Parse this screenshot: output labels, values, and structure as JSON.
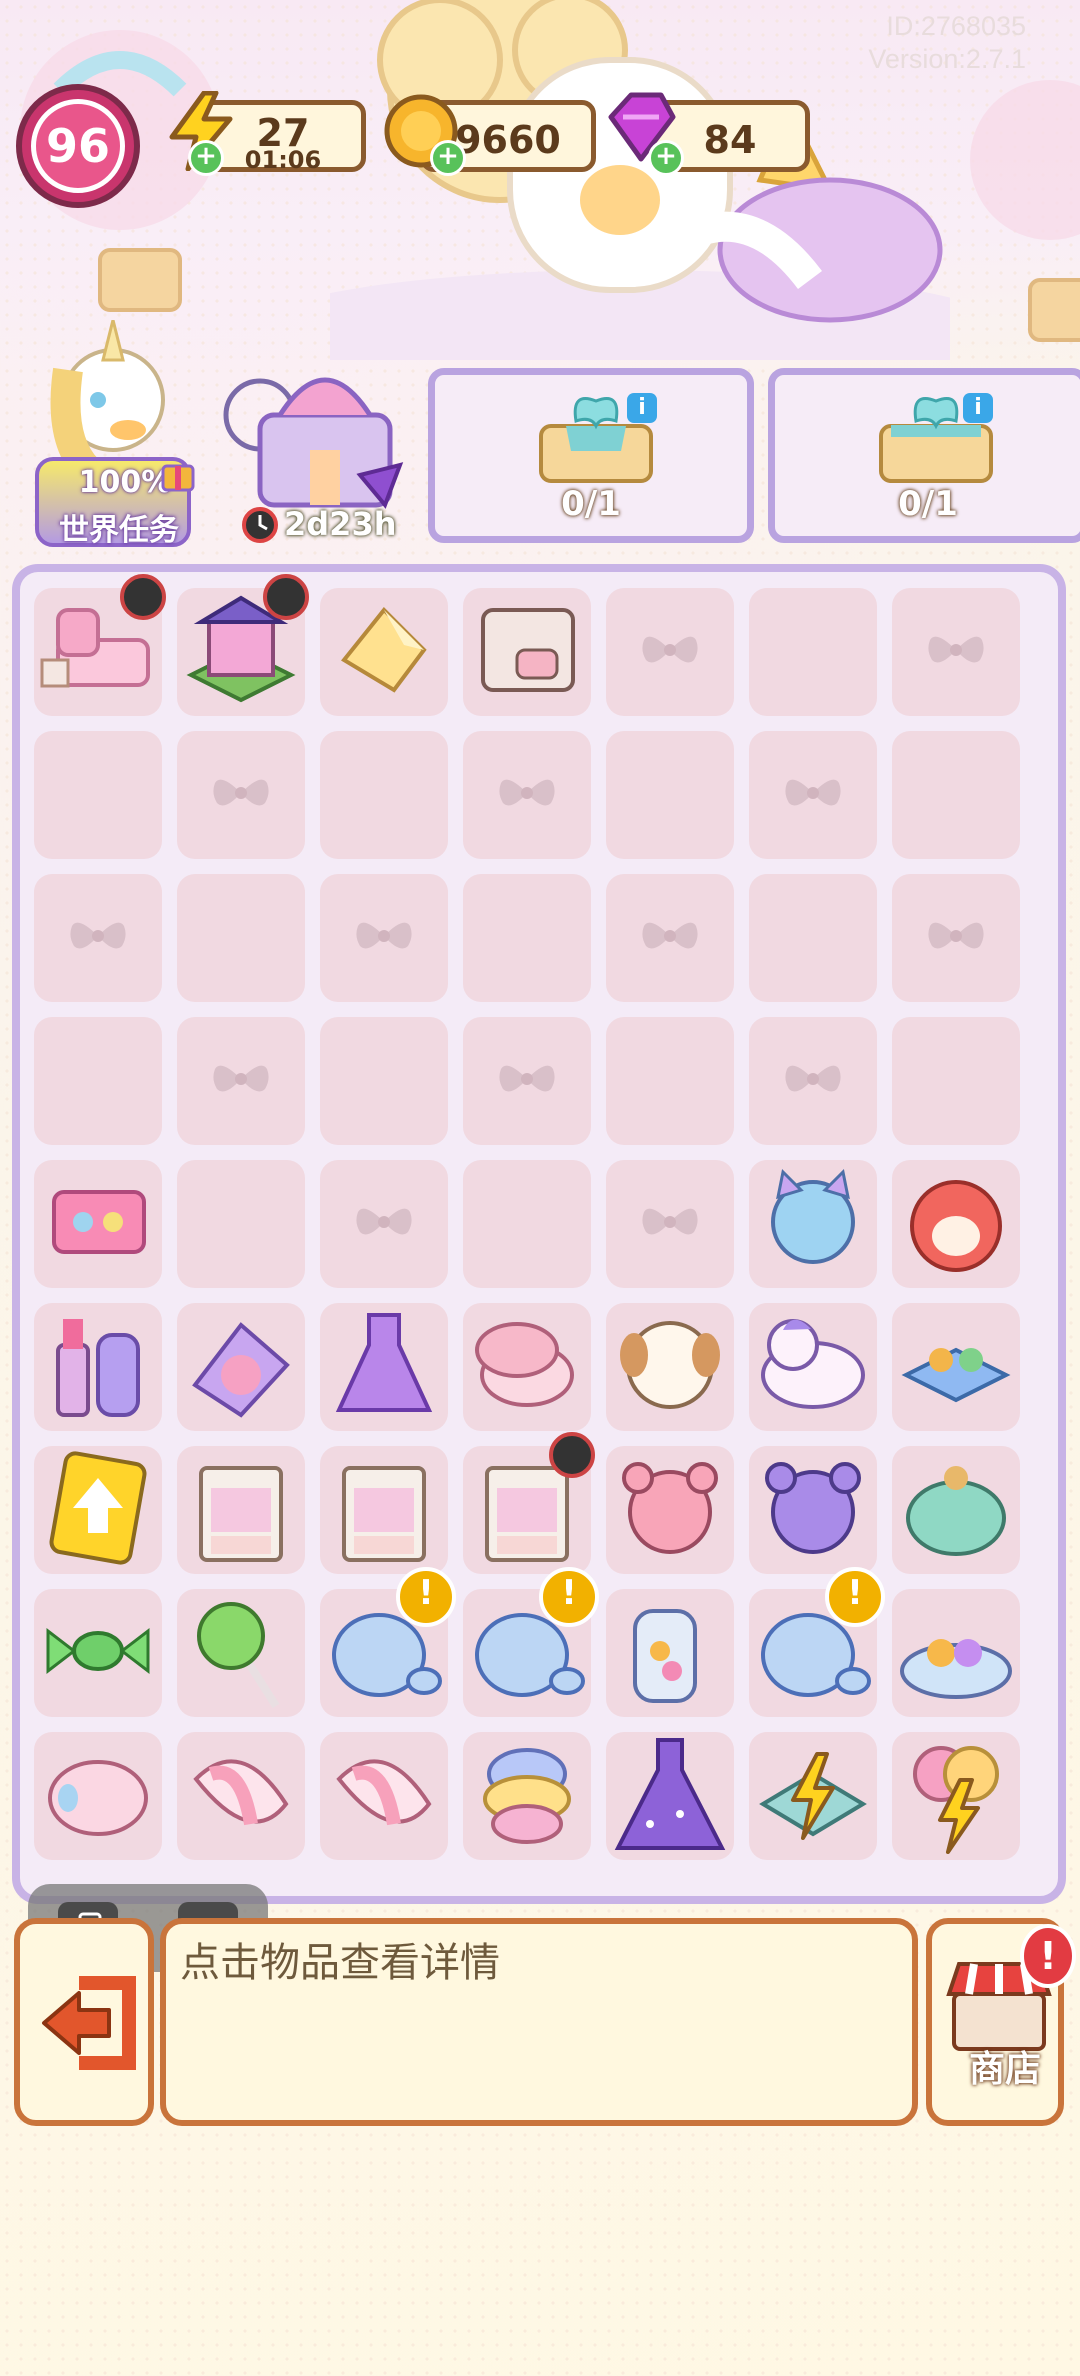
{
  "header": {
    "id_label": "ID:2768035",
    "version_label": "Version:2.7.1"
  },
  "player": {
    "level": "96"
  },
  "resources": {
    "energy": {
      "value": "27",
      "timer": "01:06"
    },
    "coins": {
      "value": "9660"
    },
    "gems": {
      "value": "84"
    }
  },
  "world_task": {
    "progress": "100%",
    "label": "世界任务"
  },
  "event": {
    "timer": "2d23h"
  },
  "orders": [
    {
      "count": "0/1",
      "info": "i"
    },
    {
      "count": "0/1",
      "info": "i"
    }
  ],
  "board": {
    "rows": [
      [
        "bed-set",
        "dollhouse",
        "butter-slice",
        "pig-dresser",
        "empty-bow",
        "empty",
        "empty-bow"
      ],
      [
        "empty",
        "empty-bow",
        "empty",
        "empty-bow",
        "empty",
        "empty-bow",
        "empty"
      ],
      [
        "empty-bow",
        "empty",
        "empty-bow",
        "empty",
        "empty-bow",
        "empty",
        "empty-bow"
      ],
      [
        "empty",
        "empty-bow",
        "empty",
        "empty-bow",
        "empty",
        "empty-bow",
        "empty"
      ],
      [
        "eyeshadow-palette",
        "empty",
        "empty-bow",
        "empty",
        "empty-bow",
        "blue-cat-plush",
        "red-hamster-plush"
      ],
      [
        "lipstick-set",
        "blush-compact",
        "purple-dress",
        "powder-box",
        "puppy-plush",
        "unicorn-plush",
        "candy-box"
      ],
      [
        "upgrade-card",
        "wardrobe",
        "wardrobe",
        "wardrobe",
        "pink-bear-plush",
        "purple-bear-plush",
        "seal-plush"
      ],
      [
        "wrapped-candy",
        "lollipop",
        "glass-jar",
        "glass-jar",
        "candy-jar",
        "glass-jar",
        "candy-plate"
      ],
      [
        "marshmallow",
        "marshmallow-pink",
        "marshmallow-pink",
        "pastel-cotton-candy",
        "ball-gown",
        "energy-gift-box",
        "energy-balloon"
      ]
    ]
  },
  "floating_tools": {
    "copy_icon": "copy-icon",
    "close_label": "×"
  },
  "info_panel": {
    "hint": "点击物品查看详情"
  },
  "shop": {
    "label": "商店",
    "alert": "!"
  },
  "alert_mark": "!"
}
